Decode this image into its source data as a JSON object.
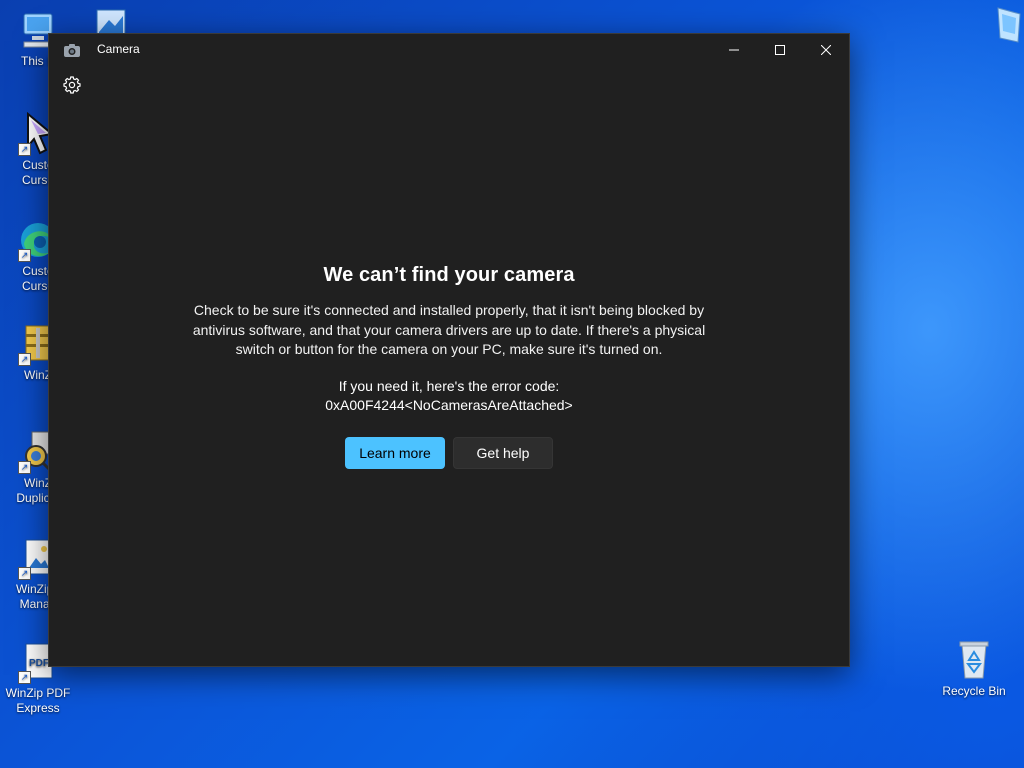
{
  "desktop": {
    "icons": [
      {
        "label": "This P",
        "icon": "computer-icon"
      },
      {
        "label": "Custo\nCurso",
        "icon": "cursor-icon"
      },
      {
        "label": "Custo\nCurso",
        "icon": "edge-icon"
      },
      {
        "label": "WinZ",
        "icon": "winzip-icon"
      },
      {
        "label": "WinZ\nDuplicat",
        "icon": "winzip-duplicate-icon"
      },
      {
        "label": "WinZip I\nManag",
        "icon": "winzip-image-icon"
      },
      {
        "label": "WinZip PDF\nExpress",
        "icon": "pdf-icon"
      },
      {
        "label": "Recycle Bin",
        "icon": "recycle-bin-icon"
      }
    ]
  },
  "window": {
    "title": "Camera",
    "icons": {
      "app": "camera-icon",
      "settings": "gear-icon",
      "minimize": "minimize-icon",
      "maximize": "maximize-icon",
      "close": "close-icon"
    }
  },
  "error": {
    "heading": "We can’t find your camera",
    "body": "Check to be sure it's connected and installed properly, that it isn't being blocked by antivirus software, and that your camera drivers are up to date. If there's a physical switch or button for the camera on your PC, make sure it's turned on.",
    "code_intro": "If you need it, here's the error code:",
    "code": "0xA00F4244<NoCamerasAreAttached>"
  },
  "buttons": {
    "learn_more": "Learn more",
    "get_help": "Get help"
  },
  "colors": {
    "accent": "#4cc2ff",
    "window_bg": "#202020"
  }
}
